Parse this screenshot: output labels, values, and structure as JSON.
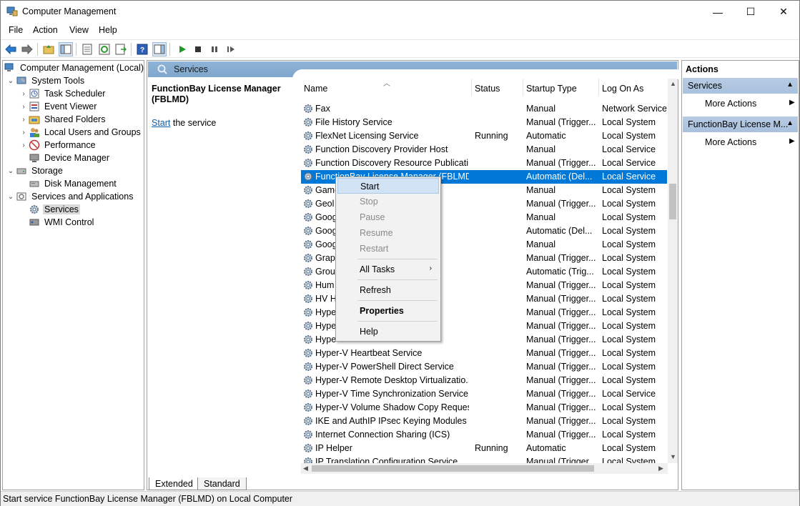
{
  "window": {
    "title": "Computer Management",
    "minimize": "—",
    "maximize": "☐",
    "close": "✕"
  },
  "menu": [
    "File",
    "Action",
    "View",
    "Help"
  ],
  "tree": {
    "items": [
      {
        "label": "Computer Management (Local)",
        "icon": "computer-management-icon"
      },
      {
        "label": "System Tools",
        "icon": "system-tools-icon"
      },
      {
        "label": "Task Scheduler",
        "icon": "task-scheduler-icon"
      },
      {
        "label": "Event Viewer",
        "icon": "event-viewer-icon"
      },
      {
        "label": "Shared Folders",
        "icon": "shared-folders-icon"
      },
      {
        "label": "Local Users and Groups",
        "icon": "users-icon"
      },
      {
        "label": "Performance",
        "icon": "performance-icon"
      },
      {
        "label": "Device Manager",
        "icon": "device-manager-icon"
      },
      {
        "label": "Storage",
        "icon": "storage-icon"
      },
      {
        "label": "Disk Management",
        "icon": "disk-icon"
      },
      {
        "label": "Services and Applications",
        "icon": "services-apps-icon"
      },
      {
        "label": "Services",
        "icon": "gear-icon"
      },
      {
        "label": "WMI Control",
        "icon": "wmi-icon"
      }
    ]
  },
  "middle": {
    "header": "Services",
    "description": {
      "title": "FunctionBay License Manager (FBLMD)",
      "link": "Start",
      "link_suffix": " the service"
    },
    "columns": {
      "name": "Name",
      "status": "Status",
      "startup": "Startup Type",
      "logon": "Log On As"
    },
    "rows": [
      {
        "name": "Fax",
        "status": "",
        "startup": "Manual",
        "logon": "Network Service"
      },
      {
        "name": "File History Service",
        "status": "",
        "startup": "Manual (Trigger...",
        "logon": "Local System"
      },
      {
        "name": "FlexNet Licensing Service",
        "status": "Running",
        "startup": "Automatic",
        "logon": "Local System"
      },
      {
        "name": "Function Discovery Provider Host",
        "status": "",
        "startup": "Manual",
        "logon": "Local Service"
      },
      {
        "name": "Function Discovery Resource Publicati...",
        "status": "",
        "startup": "Manual (Trigger...",
        "logon": "Local Service"
      },
      {
        "name": "FunctionBay License Manager (FBLMD)",
        "status": "",
        "startup": "Automatic (Del...",
        "logon": "Local Service"
      },
      {
        "name": "Game                                  ervice_...",
        "status": "",
        "startup": "Manual",
        "logon": "Local System"
      },
      {
        "name": "Geol",
        "status": "",
        "startup": "Manual (Trigger...",
        "logon": "Local System"
      },
      {
        "name": "Goog                                    (Goo...",
        "status": "",
        "startup": "Manual",
        "logon": "Local System"
      },
      {
        "name": "Goog",
        "status": "",
        "startup": "Automatic (Del...",
        "logon": "Local System"
      },
      {
        "name": "Goog                                    n)",
        "status": "",
        "startup": "Manual",
        "logon": "Local System"
      },
      {
        "name": "Graph",
        "status": "",
        "startup": "Manual (Trigger...",
        "logon": "Local System"
      },
      {
        "name": "Grou",
        "status": "",
        "startup": "Automatic (Trig...",
        "logon": "Local System"
      },
      {
        "name": "Hum",
        "status": "",
        "startup": "Manual (Trigger...",
        "logon": "Local System"
      },
      {
        "name": "HV H",
        "status": "",
        "startup": "Manual (Trigger...",
        "logon": "Local System"
      },
      {
        "name": "Hype",
        "status": "",
        "startup": "Manual (Trigger...",
        "logon": "Local System"
      },
      {
        "name": "Hype",
        "status": "",
        "startup": "Manual (Trigger...",
        "logon": "Local System"
      },
      {
        "name": "Hype",
        "status": "",
        "startup": "Manual (Trigger...",
        "logon": "Local System"
      },
      {
        "name": "Hyper-V Heartbeat Service",
        "status": "",
        "startup": "Manual (Trigger...",
        "logon": "Local System"
      },
      {
        "name": "Hyper-V PowerShell Direct Service",
        "status": "",
        "startup": "Manual (Trigger...",
        "logon": "Local System"
      },
      {
        "name": "Hyper-V Remote Desktop Virtualizatio...",
        "status": "",
        "startup": "Manual (Trigger...",
        "logon": "Local System"
      },
      {
        "name": "Hyper-V Time Synchronization Service",
        "status": "",
        "startup": "Manual (Trigger...",
        "logon": "Local Service"
      },
      {
        "name": "Hyper-V Volume Shadow Copy Reques...",
        "status": "",
        "startup": "Manual (Trigger...",
        "logon": "Local System"
      },
      {
        "name": "IKE and AuthIP IPsec Keying Modules",
        "status": "",
        "startup": "Manual (Trigger...",
        "logon": "Local System"
      },
      {
        "name": "Internet Connection Sharing (ICS)",
        "status": "",
        "startup": "Manual (Trigger...",
        "logon": "Local System"
      },
      {
        "name": "IP Helper",
        "status": "Running",
        "startup": "Automatic",
        "logon": "Local System"
      },
      {
        "name": "IP Translation Configuration Service",
        "status": "",
        "startup": "Manual (Trigger...",
        "logon": "Local System"
      }
    ],
    "tabs": [
      "Extended",
      "Standard"
    ]
  },
  "actions": {
    "title": "Actions",
    "sections": [
      {
        "label": "Services",
        "item": "More Actions"
      },
      {
        "label": "FunctionBay License M...",
        "item": "More Actions"
      }
    ]
  },
  "context_menu": {
    "start": "Start",
    "stop": "Stop",
    "pause": "Pause",
    "resume": "Resume",
    "restart": "Restart",
    "all_tasks": "All Tasks",
    "refresh": "Refresh",
    "properties": "Properties",
    "help": "Help"
  },
  "statusbar": "Start service FunctionBay License Manager (FBLMD) on Local Computer",
  "colors": {
    "selection": "#0078d7",
    "header": "#8eb3d6",
    "link": "#0b5ea8"
  }
}
